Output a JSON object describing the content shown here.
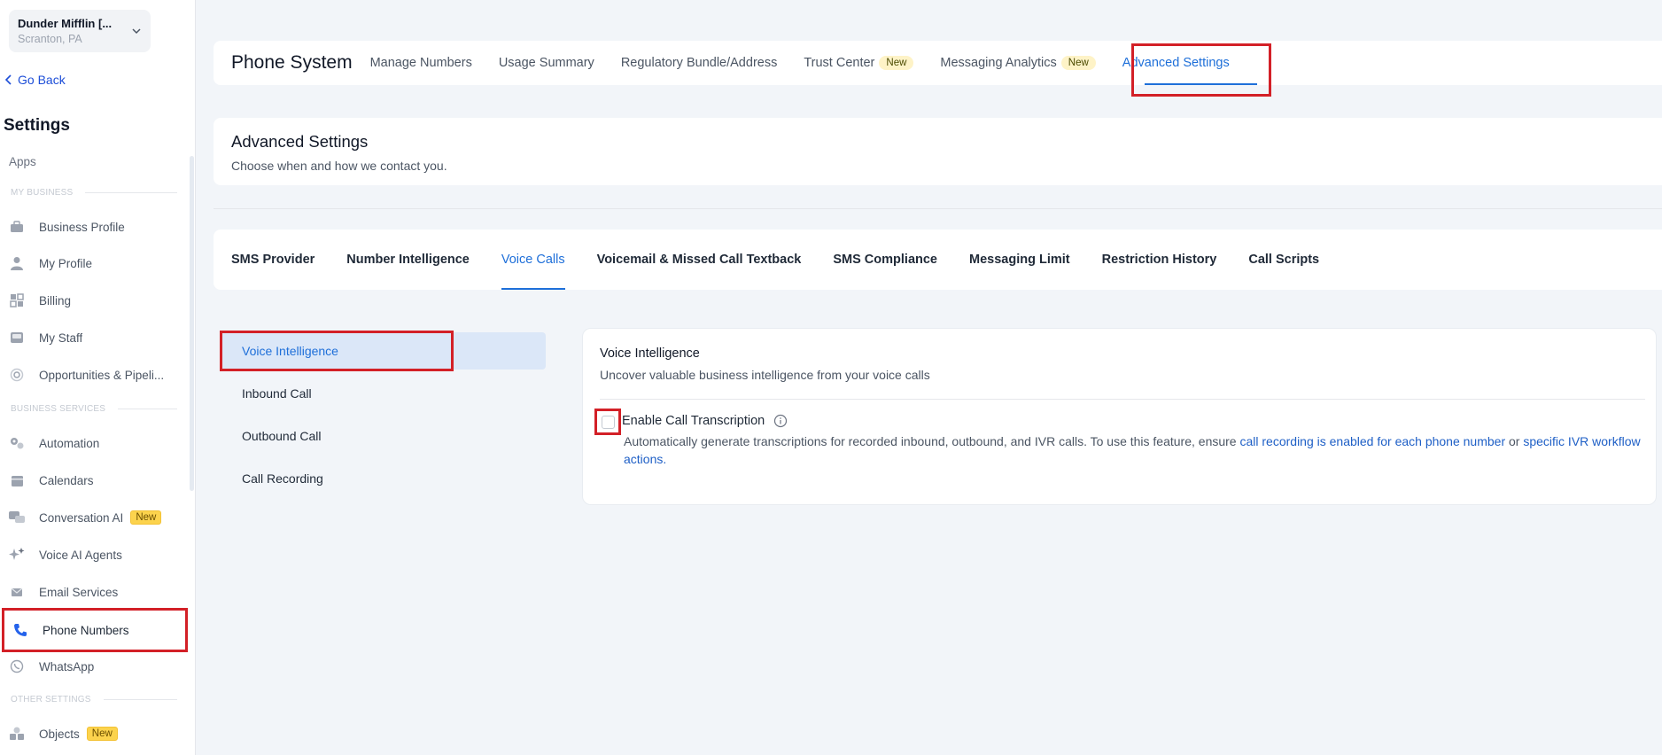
{
  "sidebar": {
    "location_name": "Dunder Mifflin [...",
    "location_sub": "Scranton, PA",
    "go_back": "Go Back",
    "settings_title": "Settings",
    "apps": "Apps",
    "section_my_business": "MY BUSINESS",
    "section_business_services": "BUSINESS SERVICES",
    "section_other_settings": "OTHER SETTINGS",
    "items": [
      {
        "label": "Business Profile",
        "icon": "briefcase-icon"
      },
      {
        "label": "My Profile",
        "icon": "user-icon"
      },
      {
        "label": "Billing",
        "icon": "grid-icon"
      },
      {
        "label": "My Staff",
        "icon": "staff-icon"
      },
      {
        "label": "Opportunities & Pipeli...",
        "icon": "target-icon"
      },
      {
        "label": "Automation",
        "icon": "gears-icon"
      },
      {
        "label": "Calendars",
        "icon": "calendar-icon"
      },
      {
        "label": "Conversation AI",
        "icon": "chat-icon",
        "badge": "New"
      },
      {
        "label": "Voice AI Agents",
        "icon": "sparkle-icon"
      },
      {
        "label": "Email Services",
        "icon": "email-icon"
      },
      {
        "label": "Phone Numbers",
        "icon": "phone-icon"
      },
      {
        "label": "WhatsApp",
        "icon": "whatsapp-icon"
      },
      {
        "label": "Objects",
        "icon": "objects-icon",
        "badge": "New"
      }
    ]
  },
  "header": {
    "title": "Phone System",
    "tabs": [
      {
        "label": "Manage Numbers"
      },
      {
        "label": "Usage Summary"
      },
      {
        "label": "Regulatory Bundle/Address"
      },
      {
        "label": "Trust Center",
        "badge": "New"
      },
      {
        "label": "Messaging Analytics",
        "badge": "New"
      },
      {
        "label": "Advanced Settings"
      }
    ]
  },
  "advanced": {
    "title": "Advanced Settings",
    "subtitle": "Choose when and how we contact you."
  },
  "subtabs": [
    "SMS Provider",
    "Number Intelligence",
    "Voice Calls",
    "Voicemail & Missed Call Textback",
    "SMS Compliance",
    "Messaging Limit",
    "Restriction History",
    "Call Scripts"
  ],
  "subnav": [
    "Voice Intelligence",
    "Inbound Call",
    "Outbound Call",
    "Call Recording"
  ],
  "voice_intelligence": {
    "title": "Voice Intelligence",
    "subtitle": "Uncover valuable business intelligence from your voice calls",
    "checkbox_label": "Enable Call Transcription",
    "checkbox_checked": false,
    "desc_text": "Automatically generate transcriptions for recorded inbound, outbound, and IVR calls. To use this feature, ensure ",
    "desc_link1": "call recording is enabled for each phone number",
    "desc_or": " or ",
    "desc_link2": "specific IVR workflow actions."
  },
  "colors": {
    "accent": "#1e6fd9",
    "highlight_box": "#d32027",
    "badge_new": "#fcd34d"
  }
}
